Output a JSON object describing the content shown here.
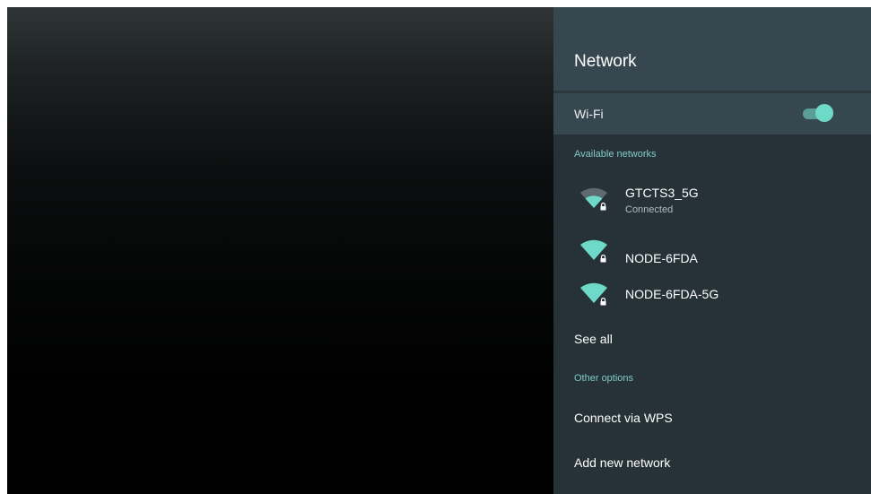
{
  "panel": {
    "title": "Network"
  },
  "wifi": {
    "label": "Wi-Fi",
    "enabled": true,
    "accent_color": "#6fd9c8"
  },
  "available_networks": {
    "heading": "Available networks",
    "items": [
      {
        "name": "GTCTS3_5G",
        "status": "Connected",
        "icon": "wifi-locked-weak-icon"
      },
      {
        "name": "NODE-6FDA",
        "status": "",
        "icon": "wifi-locked-full-icon"
      },
      {
        "name": "NODE-6FDA-5G",
        "status": "",
        "icon": "wifi-locked-full-icon"
      }
    ],
    "see_all_label": "See all"
  },
  "other_options": {
    "heading": "Other options",
    "connect_wps_label": "Connect via WPS",
    "add_network_label": "Add new network"
  }
}
